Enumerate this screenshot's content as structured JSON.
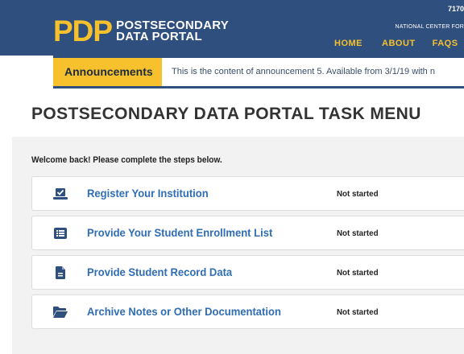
{
  "header": {
    "logo_mark": "PDP",
    "logo_line1": "POSTSECONDARY",
    "logo_line2": "DATA PORTAL",
    "top_number": "7170",
    "center_text": "NATIONAL CENTER FOR",
    "nav": [
      {
        "label": "HOME"
      },
      {
        "label": "ABOUT"
      },
      {
        "label": "FAQS"
      }
    ]
  },
  "announcement": {
    "label": "Announcements",
    "text": "This is the content of announcement 5. Available from 3/1/19 with n"
  },
  "page": {
    "title": "POSTSECONDARY DATA PORTAL TASK MENU",
    "welcome": "Welcome back! Please complete the steps below."
  },
  "tasks": [
    {
      "label": "Register Your Institution",
      "status": "Not started",
      "icon": "register-checkbox-icon"
    },
    {
      "label": "Provide Your Student Enrollment List",
      "status": "Not started",
      "icon": "list-icon"
    },
    {
      "label": "Provide Student Record Data",
      "status": "Not started",
      "icon": "document-icon"
    },
    {
      "label": "Archive Notes or Other Documentation",
      "status": "Not started",
      "icon": "folder-open-icon"
    }
  ],
  "colors": {
    "header_bg": "#2f4f7e",
    "accent_yellow": "#f6c12c",
    "link_blue": "#2f6db5",
    "panel_bg": "#f2f2f2"
  }
}
